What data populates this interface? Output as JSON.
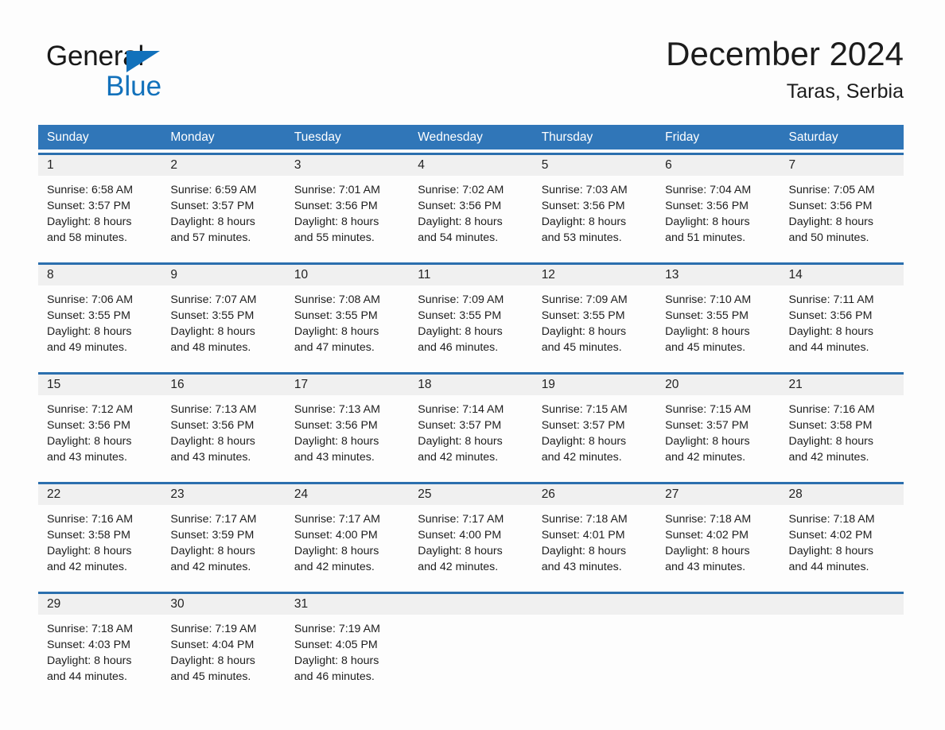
{
  "brand": {
    "name_part1": "General",
    "name_part2": "Blue",
    "accent_color": "#1271bb"
  },
  "header": {
    "title": "December 2024",
    "location": "Taras, Serbia"
  },
  "calendar": {
    "header_color": "#3076b8",
    "row_divider_color": "#2b6fae",
    "daynum_band_color": "#f0f0f0",
    "weekdays": [
      "Sunday",
      "Monday",
      "Tuesday",
      "Wednesday",
      "Thursday",
      "Friday",
      "Saturday"
    ],
    "weeks": [
      [
        {
          "day": "1",
          "sunrise": "Sunrise: 6:58 AM",
          "sunset": "Sunset: 3:57 PM",
          "daylight_line1": "Daylight: 8 hours",
          "daylight_line2": "and 58 minutes."
        },
        {
          "day": "2",
          "sunrise": "Sunrise: 6:59 AM",
          "sunset": "Sunset: 3:57 PM",
          "daylight_line1": "Daylight: 8 hours",
          "daylight_line2": "and 57 minutes."
        },
        {
          "day": "3",
          "sunrise": "Sunrise: 7:01 AM",
          "sunset": "Sunset: 3:56 PM",
          "daylight_line1": "Daylight: 8 hours",
          "daylight_line2": "and 55 minutes."
        },
        {
          "day": "4",
          "sunrise": "Sunrise: 7:02 AM",
          "sunset": "Sunset: 3:56 PM",
          "daylight_line1": "Daylight: 8 hours",
          "daylight_line2": "and 54 minutes."
        },
        {
          "day": "5",
          "sunrise": "Sunrise: 7:03 AM",
          "sunset": "Sunset: 3:56 PM",
          "daylight_line1": "Daylight: 8 hours",
          "daylight_line2": "and 53 minutes."
        },
        {
          "day": "6",
          "sunrise": "Sunrise: 7:04 AM",
          "sunset": "Sunset: 3:56 PM",
          "daylight_line1": "Daylight: 8 hours",
          "daylight_line2": "and 51 minutes."
        },
        {
          "day": "7",
          "sunrise": "Sunrise: 7:05 AM",
          "sunset": "Sunset: 3:56 PM",
          "daylight_line1": "Daylight: 8 hours",
          "daylight_line2": "and 50 minutes."
        }
      ],
      [
        {
          "day": "8",
          "sunrise": "Sunrise: 7:06 AM",
          "sunset": "Sunset: 3:55 PM",
          "daylight_line1": "Daylight: 8 hours",
          "daylight_line2": "and 49 minutes."
        },
        {
          "day": "9",
          "sunrise": "Sunrise: 7:07 AM",
          "sunset": "Sunset: 3:55 PM",
          "daylight_line1": "Daylight: 8 hours",
          "daylight_line2": "and 48 minutes."
        },
        {
          "day": "10",
          "sunrise": "Sunrise: 7:08 AM",
          "sunset": "Sunset: 3:55 PM",
          "daylight_line1": "Daylight: 8 hours",
          "daylight_line2": "and 47 minutes."
        },
        {
          "day": "11",
          "sunrise": "Sunrise: 7:09 AM",
          "sunset": "Sunset: 3:55 PM",
          "daylight_line1": "Daylight: 8 hours",
          "daylight_line2": "and 46 minutes."
        },
        {
          "day": "12",
          "sunrise": "Sunrise: 7:09 AM",
          "sunset": "Sunset: 3:55 PM",
          "daylight_line1": "Daylight: 8 hours",
          "daylight_line2": "and 45 minutes."
        },
        {
          "day": "13",
          "sunrise": "Sunrise: 7:10 AM",
          "sunset": "Sunset: 3:55 PM",
          "daylight_line1": "Daylight: 8 hours",
          "daylight_line2": "and 45 minutes."
        },
        {
          "day": "14",
          "sunrise": "Sunrise: 7:11 AM",
          "sunset": "Sunset: 3:56 PM",
          "daylight_line1": "Daylight: 8 hours",
          "daylight_line2": "and 44 minutes."
        }
      ],
      [
        {
          "day": "15",
          "sunrise": "Sunrise: 7:12 AM",
          "sunset": "Sunset: 3:56 PM",
          "daylight_line1": "Daylight: 8 hours",
          "daylight_line2": "and 43 minutes."
        },
        {
          "day": "16",
          "sunrise": "Sunrise: 7:13 AM",
          "sunset": "Sunset: 3:56 PM",
          "daylight_line1": "Daylight: 8 hours",
          "daylight_line2": "and 43 minutes."
        },
        {
          "day": "17",
          "sunrise": "Sunrise: 7:13 AM",
          "sunset": "Sunset: 3:56 PM",
          "daylight_line1": "Daylight: 8 hours",
          "daylight_line2": "and 43 minutes."
        },
        {
          "day": "18",
          "sunrise": "Sunrise: 7:14 AM",
          "sunset": "Sunset: 3:57 PM",
          "daylight_line1": "Daylight: 8 hours",
          "daylight_line2": "and 42 minutes."
        },
        {
          "day": "19",
          "sunrise": "Sunrise: 7:15 AM",
          "sunset": "Sunset: 3:57 PM",
          "daylight_line1": "Daylight: 8 hours",
          "daylight_line2": "and 42 minutes."
        },
        {
          "day": "20",
          "sunrise": "Sunrise: 7:15 AM",
          "sunset": "Sunset: 3:57 PM",
          "daylight_line1": "Daylight: 8 hours",
          "daylight_line2": "and 42 minutes."
        },
        {
          "day": "21",
          "sunrise": "Sunrise: 7:16 AM",
          "sunset": "Sunset: 3:58 PM",
          "daylight_line1": "Daylight: 8 hours",
          "daylight_line2": "and 42 minutes."
        }
      ],
      [
        {
          "day": "22",
          "sunrise": "Sunrise: 7:16 AM",
          "sunset": "Sunset: 3:58 PM",
          "daylight_line1": "Daylight: 8 hours",
          "daylight_line2": "and 42 minutes."
        },
        {
          "day": "23",
          "sunrise": "Sunrise: 7:17 AM",
          "sunset": "Sunset: 3:59 PM",
          "daylight_line1": "Daylight: 8 hours",
          "daylight_line2": "and 42 minutes."
        },
        {
          "day": "24",
          "sunrise": "Sunrise: 7:17 AM",
          "sunset": "Sunset: 4:00 PM",
          "daylight_line1": "Daylight: 8 hours",
          "daylight_line2": "and 42 minutes."
        },
        {
          "day": "25",
          "sunrise": "Sunrise: 7:17 AM",
          "sunset": "Sunset: 4:00 PM",
          "daylight_line1": "Daylight: 8 hours",
          "daylight_line2": "and 42 minutes."
        },
        {
          "day": "26",
          "sunrise": "Sunrise: 7:18 AM",
          "sunset": "Sunset: 4:01 PM",
          "daylight_line1": "Daylight: 8 hours",
          "daylight_line2": "and 43 minutes."
        },
        {
          "day": "27",
          "sunrise": "Sunrise: 7:18 AM",
          "sunset": "Sunset: 4:02 PM",
          "daylight_line1": "Daylight: 8 hours",
          "daylight_line2": "and 43 minutes."
        },
        {
          "day": "28",
          "sunrise": "Sunrise: 7:18 AM",
          "sunset": "Sunset: 4:02 PM",
          "daylight_line1": "Daylight: 8 hours",
          "daylight_line2": "and 44 minutes."
        }
      ],
      [
        {
          "day": "29",
          "sunrise": "Sunrise: 7:18 AM",
          "sunset": "Sunset: 4:03 PM",
          "daylight_line1": "Daylight: 8 hours",
          "daylight_line2": "and 44 minutes."
        },
        {
          "day": "30",
          "sunrise": "Sunrise: 7:19 AM",
          "sunset": "Sunset: 4:04 PM",
          "daylight_line1": "Daylight: 8 hours",
          "daylight_line2": "and 45 minutes."
        },
        {
          "day": "31",
          "sunrise": "Sunrise: 7:19 AM",
          "sunset": "Sunset: 4:05 PM",
          "daylight_line1": "Daylight: 8 hours",
          "daylight_line2": "and 46 minutes."
        },
        {
          "day": "",
          "sunrise": "",
          "sunset": "",
          "daylight_line1": "",
          "daylight_line2": "",
          "empty": true
        },
        {
          "day": "",
          "sunrise": "",
          "sunset": "",
          "daylight_line1": "",
          "daylight_line2": "",
          "empty": true
        },
        {
          "day": "",
          "sunrise": "",
          "sunset": "",
          "daylight_line1": "",
          "daylight_line2": "",
          "empty": true
        },
        {
          "day": "",
          "sunrise": "",
          "sunset": "",
          "daylight_line1": "",
          "daylight_line2": "",
          "empty": true
        }
      ]
    ]
  }
}
